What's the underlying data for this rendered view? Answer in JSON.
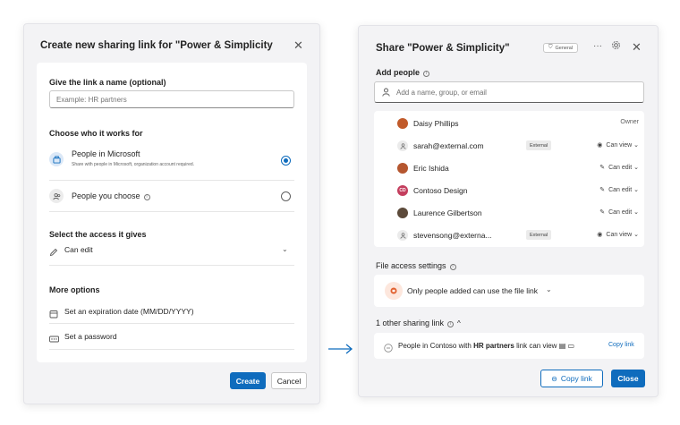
{
  "left_dialog": {
    "title": "Create new sharing link for \"Power & Simplicity",
    "close": "✕",
    "name_section": {
      "label": "Give the link a name (optional)",
      "placeholder": "Example: HR partners"
    },
    "who_section": {
      "label": "Choose who it works for",
      "options": [
        {
          "title": "People in Microsoft",
          "desc": "Share with people in Microsoft, organization account required.",
          "selected": true,
          "icon": "building-icon"
        },
        {
          "title": "People you choose",
          "desc": "",
          "selected": false,
          "icon": "people-icon"
        }
      ]
    },
    "access_section": {
      "label": "Select the access it gives",
      "value": "Can edit"
    },
    "more_section": {
      "label": "More options",
      "expiration": "Set an expiration date (MM/DD/YYYY)",
      "password": "Set a password"
    },
    "buttons": {
      "create": "Create",
      "cancel": "Cancel"
    }
  },
  "right_dialog": {
    "title": "Share \"Power & Simplicity\"",
    "badge": "General",
    "more": "···",
    "close": "✕",
    "add_people": {
      "label": "Add people",
      "placeholder": "Add a name, group, or email"
    },
    "people": [
      {
        "name": "Daisy Phillips",
        "external": false,
        "permission": "Owner",
        "avatar_color": "#c15a2a",
        "avatar_text": ""
      },
      {
        "name": "sarah@external.com",
        "external": true,
        "permission": "Can view",
        "avatar_color": "",
        "avatar_text": ""
      },
      {
        "name": "Eric Ishida",
        "external": false,
        "permission": "Can edit",
        "avatar_color": "#b5562f",
        "avatar_text": ""
      },
      {
        "name": "Contoso Design",
        "external": false,
        "permission": "Can edit",
        "avatar_color": "#c43e5e",
        "avatar_text": "CD"
      },
      {
        "name": "Laurence Gilbertson",
        "external": false,
        "permission": "Can edit",
        "avatar_color": "#5c4a3a",
        "avatar_text": ""
      },
      {
        "name": "stevensong@externa...",
        "external": true,
        "permission": "Can view",
        "avatar_color": "",
        "avatar_text": ""
      }
    ],
    "external_badge": "External",
    "file_access": {
      "label": "File access settings",
      "value": "Only people added can use the file link"
    },
    "other_links": {
      "label": "1 other sharing link",
      "text_before": "People in Contoso with",
      "text_bold": "HR partners",
      "text_after": "link can view",
      "copy": "Copy link"
    },
    "buttons": {
      "copy": "Copy link",
      "close": "Close"
    }
  },
  "colors": {
    "accent": "#0f6cbd",
    "dialog_bg": "#f3f3f5"
  }
}
